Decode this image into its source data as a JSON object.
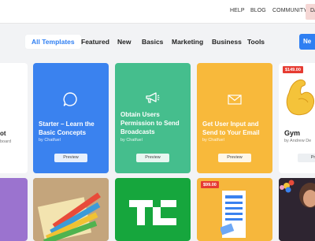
{
  "topnav": {
    "help": "HELP",
    "blog": "BLOG",
    "community": "COMMUNITY",
    "dashboard_cut": "DA"
  },
  "tabs": [
    "All Templates",
    "Featured",
    "New",
    "Basics",
    "Marketing",
    "Business",
    "Tools"
  ],
  "new_button_cut": "Ne",
  "cards_row1": [
    {
      "title_cut": "ot",
      "by_cut": "board"
    },
    {
      "title": "Starter – Learn the Basic Concepts",
      "by": "by Chatfuel",
      "preview": "Preview",
      "color": "#3a82ef"
    },
    {
      "title": "Obtain Users Permission to Send Broadcasts",
      "by": "by Chatfuel",
      "preview": "Preview",
      "color": "#45be8d"
    },
    {
      "title": "Get User Input and Send to Your Email",
      "by": "by Chatfuel",
      "preview": "Preview",
      "color": "#f8b93b"
    },
    {
      "title": "Gym",
      "by": "by Andrew De",
      "preview": "Pre",
      "price": "$149.00"
    }
  ],
  "cards_row2": [
    {
      "color": "#9b73cf"
    },
    {
      "color": "#c9a77a"
    },
    {
      "color": "#16a63d"
    },
    {
      "color": "#f6b73c",
      "price": "$99.00"
    },
    {
      "color": "#3a2f3d"
    }
  ]
}
